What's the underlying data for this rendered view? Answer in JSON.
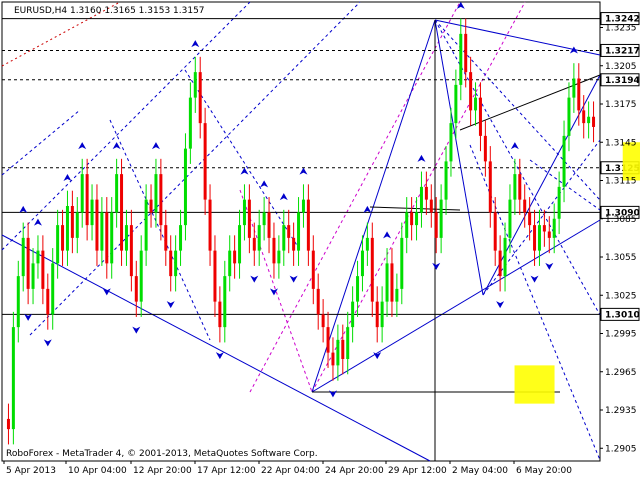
{
  "window": {
    "symbol_line": "EURUSD,H4  1.3160 1.3165 1.3153 1.3157",
    "copyright": "RoboForex - MetaTrader 4, © 2001-2013, MetaQuotes Software Corp."
  },
  "colors": {
    "bull": "#00dd00",
    "bear": "#ee0000",
    "trend": "#0000cc",
    "fan": "#cc00cc",
    "level": "#000080",
    "zone": "#ffff00",
    "tag_fill": "#ffffff"
  },
  "chart_data": {
    "type": "candlestick",
    "symbol": "EURUSD",
    "timeframe": "H4",
    "last_ohlc": {
      "open": 1.316,
      "high": 1.3165,
      "low": 1.3153,
      "close": 1.3157
    },
    "ylim": [
      1.2895,
      1.3255
    ],
    "y_ticks": [
      "1.3235",
      "1.3205",
      "1.3175",
      "1.3145",
      "1.3115",
      "1.3085",
      "1.3055",
      "1.3025",
      "1.2995",
      "1.2965",
      "1.2935",
      "1.2905"
    ],
    "x_ticks": [
      "5 Apr 2013",
      "10 Apr 04:00",
      "12 Apr 20:00",
      "17 Apr 12:00",
      "22 Apr 04:00",
      "24 Apr 20:00",
      "29 Apr 12:00",
      "2 May 04:00",
      "6 May 20:00"
    ],
    "levels": [
      {
        "price": "1.3242",
        "style": "solid"
      },
      {
        "price": "1.3217",
        "style": "dashed"
      },
      {
        "price": "1.3194",
        "style": "dashed"
      },
      {
        "price": "1.3125",
        "style": "dashed"
      },
      {
        "price": "1.3090",
        "style": "solid"
      },
      {
        "price": "1.3010",
        "style": "solid"
      }
    ],
    "close_series": [
      1.292,
      1.3,
      1.304,
      1.307,
      1.303,
      1.305,
      1.306,
      1.303,
      1.301,
      1.305,
      1.308,
      1.306,
      1.3095,
      1.307,
      1.309,
      1.312,
      1.308,
      1.31,
      1.306,
      1.309,
      1.305,
      1.309,
      1.312,
      1.306,
      1.308,
      1.304,
      1.302,
      1.306,
      1.31,
      1.309,
      1.312,
      1.308,
      1.306,
      1.304,
      1.306,
      1.308,
      1.314,
      1.318,
      1.32,
      1.316,
      1.31,
      1.306,
      1.302,
      1.3,
      1.304,
      1.306,
      1.305,
      1.308,
      1.31,
      1.307,
      1.306,
      1.308,
      1.309,
      1.307,
      1.305,
      1.306,
      1.308,
      1.307,
      1.306,
      1.309,
      1.31,
      1.306,
      1.303,
      1.301,
      1.3,
      1.298,
      1.297,
      1.299,
      1.2975,
      1.3,
      1.302,
      1.304,
      1.306,
      1.307,
      1.302,
      1.3,
      1.302,
      1.305,
      1.302,
      1.303,
      1.307,
      1.309,
      1.308,
      1.309,
      1.311,
      1.31,
      1.309,
      1.307,
      1.31,
      1.313,
      1.316,
      1.319,
      1.323,
      1.32,
      1.317,
      1.318,
      1.315,
      1.313,
      1.309,
      1.306,
      1.304,
      1.307,
      1.31,
      1.312,
      1.31,
      1.309,
      1.308,
      1.306,
      1.308,
      1.3075,
      1.307,
      1.3085,
      1.311,
      1.315,
      1.318,
      1.3195,
      1.317,
      1.316,
      1.3165,
      1.3157
    ],
    "zones": [
      {
        "time_index": 129,
        "price_low": 1.3115,
        "price_high": 1.3145
      },
      {
        "time_index": 107,
        "price_low": 1.294,
        "price_high": 1.297
      }
    ]
  }
}
